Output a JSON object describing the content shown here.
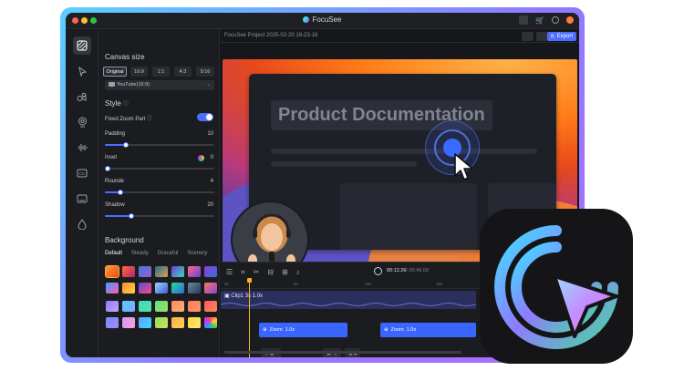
{
  "app": {
    "title": "FocuSee"
  },
  "header": {
    "project_title": "FocuSee Project 2025-02-20 18-23-16",
    "export_label": "Export"
  },
  "rail": {
    "icons": [
      "background-icon",
      "cursor-icon",
      "camera-icon",
      "webcam-icon",
      "audio-icon",
      "caption-icon",
      "layout-icon",
      "watermark-icon"
    ]
  },
  "panel": {
    "canvas_size_title": "Canvas size",
    "ratios": [
      "Original",
      "16:9",
      "1:1",
      "4:3",
      "9:16"
    ],
    "ratio_selected": "Original",
    "platform": "YouTube(16:9)",
    "style_title": "Style",
    "fixed_zoom_label": "Fixed Zoom Part",
    "fixed_zoom_on": true,
    "padding_label": "Padding",
    "padding_value": "10",
    "inset_label": "Inset",
    "inset_value": "0",
    "rounded_label": "Rounde",
    "rounded_value": "4",
    "shadow_label": "Shadow",
    "shadow_value": "20",
    "background_title": "Background",
    "bg_tabs": [
      "Default",
      "Steady",
      "Graceful",
      "Scenery"
    ]
  },
  "canvas": {
    "doc_title": "Product Documentation"
  },
  "timeline": {
    "time_current": "00:12.26",
    "time_total": "/ 00:49.68",
    "ruler": [
      "0s",
      "5s",
      "10s",
      "15s",
      "20s"
    ],
    "clip_label": "Clip1",
    "clip_duration": "3s",
    "clip_speed": "1.0x",
    "zoom_clips": [
      {
        "label": "Zoom",
        "speed": "1.0x"
      },
      {
        "label": "Zoom",
        "speed": "1.0x"
      }
    ],
    "keys": [
      "⇧ ⌘ ^",
      "⌘ ⌥",
      "⌘ A"
    ]
  },
  "colors": {
    "accent": "#4c6dff",
    "playhead": "#ffb020",
    "frame_gradient": [
      "#5ad0ff",
      "#b06bff"
    ]
  }
}
